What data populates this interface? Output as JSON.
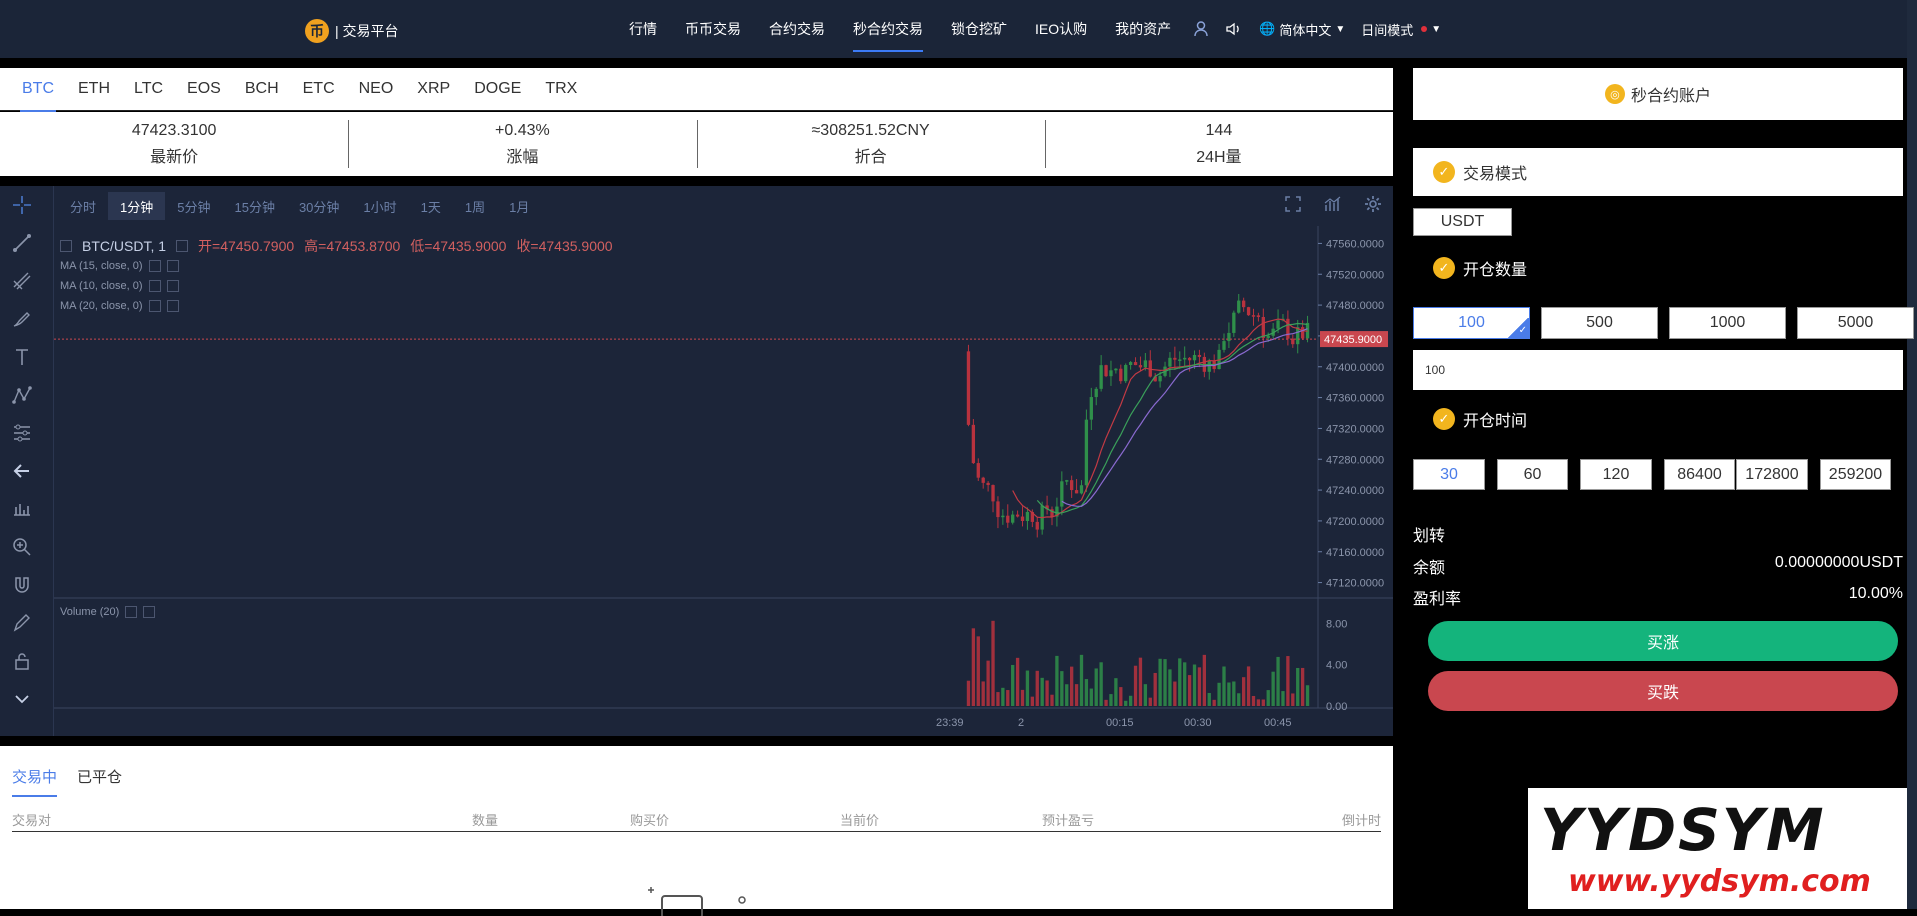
{
  "header": {
    "logo_glyph": "币",
    "logo_text": "| 交易平台",
    "nav": [
      "行情",
      "币币交易",
      "合约交易",
      "秒合约交易",
      "锁仓挖矿",
      "IEO认购",
      "我的资产"
    ],
    "active_nav": "秒合约交易",
    "language": "简体中文",
    "mode": "日间模式"
  },
  "coins": {
    "tabs": [
      "BTC",
      "ETH",
      "LTC",
      "EOS",
      "BCH",
      "ETC",
      "NEO",
      "XRP",
      "DOGE",
      "TRX"
    ],
    "active": "BTC"
  },
  "stats": [
    {
      "value": "47423.3100",
      "label": "最新价"
    },
    {
      "value": "+0.43%",
      "label": "涨幅"
    },
    {
      "value": "≈308251.52CNY",
      "label": "折合"
    },
    {
      "value": "144",
      "label": "24H量"
    }
  ],
  "chart": {
    "timeframes": [
      "分时",
      "1分钟",
      "5分钟",
      "15分钟",
      "30分钟",
      "1小时",
      "1天",
      "1周",
      "1月"
    ],
    "active_timeframe": "1分钟",
    "symbol": "BTC/USDT, 1",
    "open": "开=47450.7900",
    "high": "高=47453.8700",
    "low": "低=47435.9000",
    "close": "收=47435.9000",
    "ma": [
      "MA (15, close, 0)",
      "MA (10, close, 0)",
      "MA (20, close, 0)"
    ],
    "volume_label": "Volume (20)",
    "current_price": "47435.9000",
    "price_ticks": [
      "47560.0000",
      "47520.0000",
      "47480.0000",
      "47440.0000",
      "47400.0000",
      "47360.0000",
      "47320.0000",
      "47280.0000",
      "47240.0000",
      "47200.0000",
      "47160.0000",
      "47120.0000"
    ],
    "volume_ticks": [
      "8.00",
      "4.00",
      "0.00"
    ],
    "time_ticks": [
      "23:39",
      "2",
      "00:15",
      "00:30",
      "00:45"
    ],
    "up_color": "#2f8f4a",
    "down_color": "#b8323e"
  },
  "orders": {
    "tabs": [
      "交易中",
      "已平仓"
    ],
    "active": "交易中",
    "columns": [
      "交易对",
      "数量",
      "购买价",
      "当前价",
      "预计盈亏",
      "倒计时"
    ]
  },
  "panel": {
    "account_title": "秒合约账户",
    "mode_title": "交易模式",
    "currency": "USDT",
    "qty_title": "开仓数量",
    "qty_options": [
      "100",
      "500",
      "1000",
      "5000"
    ],
    "qty_selected": "100",
    "qty_input": "100",
    "time_title": "开仓时间",
    "time_options": [
      "30",
      "60",
      "120",
      "86400",
      "172800",
      "259200"
    ],
    "time_selected": "30",
    "transfer": "划转",
    "balance_label": "余额",
    "balance_value": "0.00000000USDT",
    "profit_label": "盈利率",
    "profit_value": "10.00%",
    "buy_up": "买涨",
    "buy_down": "买跌"
  },
  "watermark": {
    "top": "YYDSYM",
    "bottom": "www.yydsym.com"
  }
}
